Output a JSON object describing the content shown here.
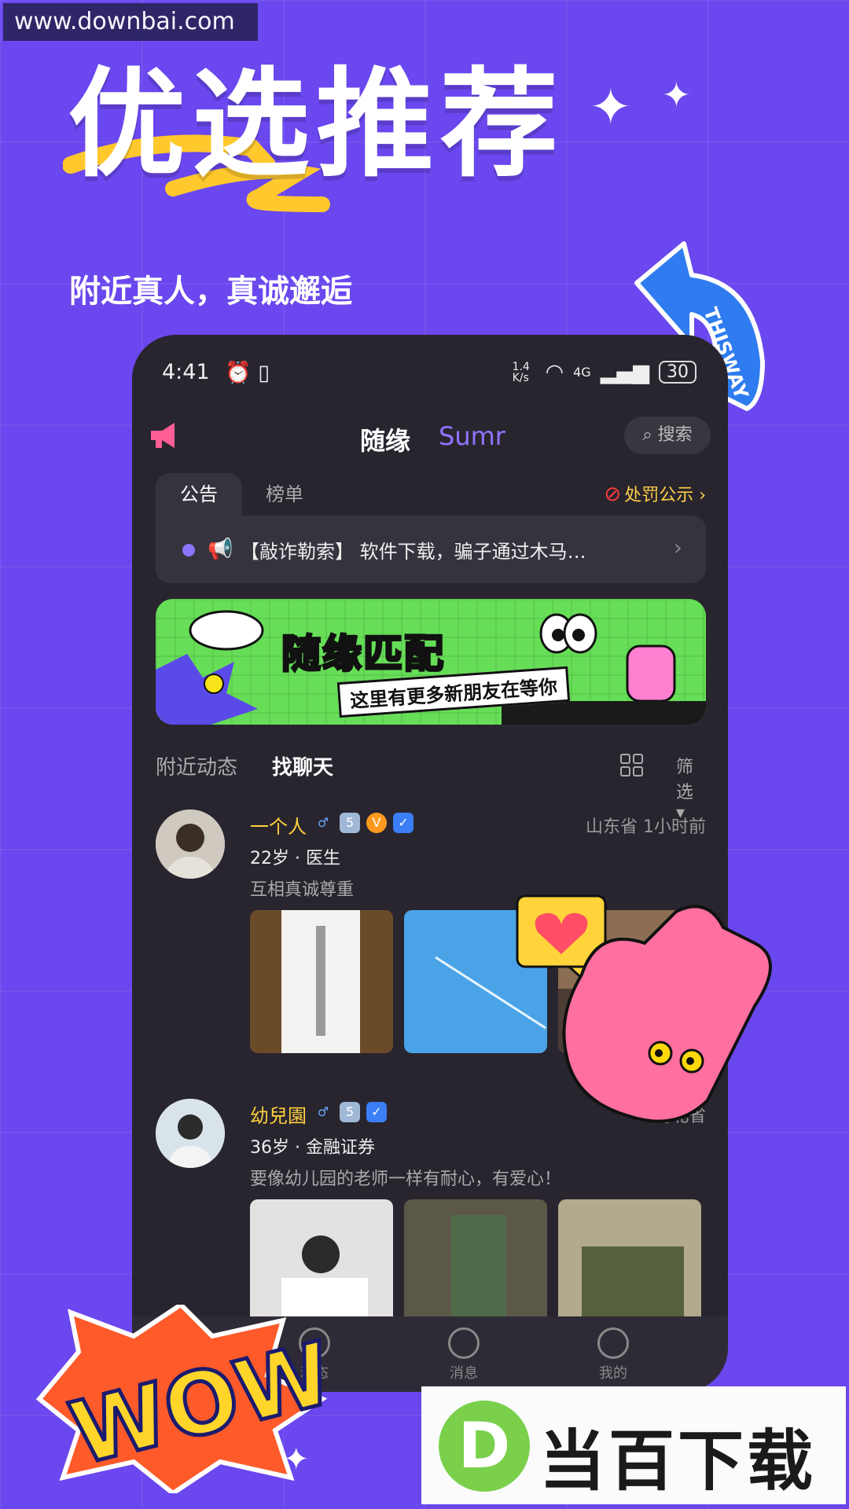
{
  "watermark": "www.downbai.com",
  "headline": "优选推荐",
  "subheadline": "附近真人，真诚邂逅",
  "arrow_sticker": "THISWAY",
  "status_bar": {
    "time": "4:41",
    "net_speed": "1.4 K/s",
    "network": "4G",
    "battery": "30"
  },
  "topbar": {
    "brand": "随缘",
    "brand_en": "Sumr",
    "search_placeholder": "搜索"
  },
  "notice": {
    "tabs": [
      "公告",
      "榜单"
    ],
    "penalty_link": "处罚公示",
    "text": "【敲诈勒索】 软件下载，骗子通过木马…"
  },
  "banner": {
    "title": "随缘匹配",
    "subtitle": "这里有更多新朋友在等你"
  },
  "feed_tabs": {
    "nearby": "附近动态",
    "chat": "找聊天",
    "filter": "筛选"
  },
  "posts": [
    {
      "name": "一个人",
      "gender": "♂",
      "level": "5",
      "location": "山东省",
      "time": "1小时前",
      "meta": "22岁 · 医生",
      "bio": "互相真诚尊重"
    },
    {
      "name": "幼兒園",
      "gender": "♂",
      "level": "5",
      "location": "河北省",
      "time": "",
      "meta": "36岁 · 金融证券",
      "bio": "要像幼儿园的老师一样有耐心，有爱心！"
    }
  ],
  "tabbar": {
    "items": [
      "动态",
      "消息",
      "我的"
    ]
  },
  "wow_sticker": "WOW",
  "footer_watermark": "当百下载",
  "footer_logo_letter": "D",
  "colors": {
    "background": "#6a47ee",
    "phone": "#28252f",
    "accent": "#8f75ff",
    "name": "#ffcf3c",
    "banner": "#66de57"
  }
}
